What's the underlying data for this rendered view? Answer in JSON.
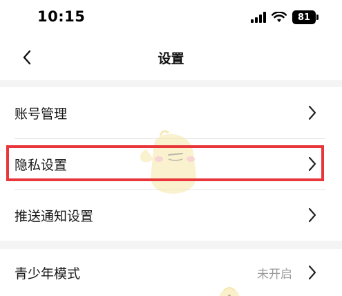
{
  "status_bar": {
    "time": "10:15",
    "battery": "81",
    "icons": [
      "signal-icon",
      "wifi-icon",
      "battery-icon"
    ]
  },
  "nav": {
    "title": "设置",
    "back_icon": "chevron-left-icon"
  },
  "settings": {
    "group1": [
      {
        "label": "账号管理",
        "value": ""
      },
      {
        "label": "隐私设置",
        "value": ""
      },
      {
        "label": "推送通知设置",
        "value": ""
      }
    ],
    "group2": [
      {
        "label": "青少年模式",
        "value": "未开启"
      }
    ]
  },
  "colors": {
    "highlight": "#e8363a",
    "background": "#f4f4f4",
    "card": "#ffffff",
    "secondary_text": "#9a9a9a"
  }
}
